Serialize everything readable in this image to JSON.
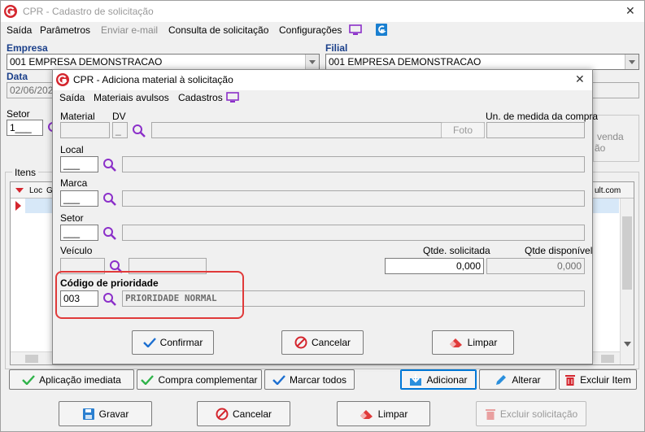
{
  "main_window": {
    "title": "CPR - Cadastro de solicitação",
    "close_glyph": "✕",
    "menu": [
      "Saída",
      "Parâmetros",
      "Enviar e-mail",
      "Consulta de solicitação",
      "Configurações"
    ],
    "empresa_label": "Empresa",
    "empresa_value": "001 EMPRESA DEMONSTRACAO",
    "filial_label": "Filial",
    "filial_value": "001 EMPRESA DEMONSTRACAO",
    "data_label": "Data",
    "data_value": "02/06/2020",
    "setor_label": "Setor",
    "setor_value": "1___",
    "itens_label": "Itens",
    "grid_col_loc": "Loc",
    "grid_col_g": "G",
    "grid_col_ult": "ult.com",
    "side_text_1": "venda",
    "side_text_2": "ão",
    "buttons_row1": {
      "aplicacao": "Aplicação imediata",
      "compra": "Compra complementar",
      "marcar": "Marcar todos",
      "adicionar": "Adicionar",
      "alterar": "Alterar",
      "excluir_item": "Excluir Item"
    },
    "buttons_row2": {
      "gravar": "Gravar",
      "cancelar": "Cancelar",
      "limpar": "Limpar",
      "excluir_sol": "Excluir solicitação"
    }
  },
  "dialog": {
    "title": "CPR - Adiciona material à solicitação",
    "close_glyph": "✕",
    "menu": [
      "Saída",
      "Materiais avulsos",
      "Cadastros"
    ],
    "material_label": "Material",
    "dv_label": "DV",
    "dv_value": "_",
    "un_label": "Un. de medida da compra",
    "foto_label": "Foto",
    "local_label": "Local",
    "local_value": "___",
    "marca_label": "Marca",
    "marca_value": "___",
    "setor_label": "Setor",
    "setor_value": "___",
    "veiculo_label": "Veículo",
    "qtde_sol_label": "Qtde. solicitada",
    "qtde_sol_value": "0,000",
    "qtde_disp_label": "Qtde disponível",
    "qtde_disp_value": "0,000",
    "prioridade_label": "Código de prioridade",
    "prioridade_code": "003",
    "prioridade_desc": "PRIORIDADE NORMAL",
    "btn_confirmar": "Confirmar",
    "btn_cancelar": "Cancelar",
    "btn_limpar": "Limpar"
  },
  "colors": {
    "accent": "#0078d7",
    "highlight_border": "#e03a3a",
    "logo": "#d4262e",
    "magnifier": "#8b2fc9",
    "monitor": "#8b2fc9"
  }
}
